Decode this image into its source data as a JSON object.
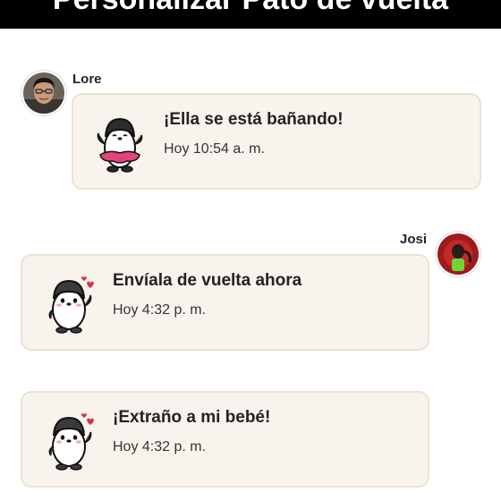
{
  "header": {
    "title": "Personalizar Pato de vuelta"
  },
  "messages": [
    {
      "sender": "Lore",
      "text": "¡Ella se está bañando!",
      "time": "Hoy 10:54 a. m.",
      "sticker": "penguin-tutu-sticker",
      "side": "left"
    },
    {
      "sender": "Josi",
      "text": "Envíala de vuelta ahora",
      "time": "Hoy 4:32 p. m.",
      "sticker": "penguin-hearts-sticker",
      "side": "right"
    },
    {
      "sender": "",
      "text": "¡Extraño a mi bebé!",
      "time": "Hoy 4:32 p. m.",
      "sticker": "penguin-hearts-sticker",
      "side": "right"
    }
  ],
  "colors": {
    "card_bg": "#f8f4ed",
    "card_border": "#ece2d3",
    "header_bg": "#000000",
    "tutu_pink": "#e3457b",
    "heart_red": "#d9344a"
  }
}
